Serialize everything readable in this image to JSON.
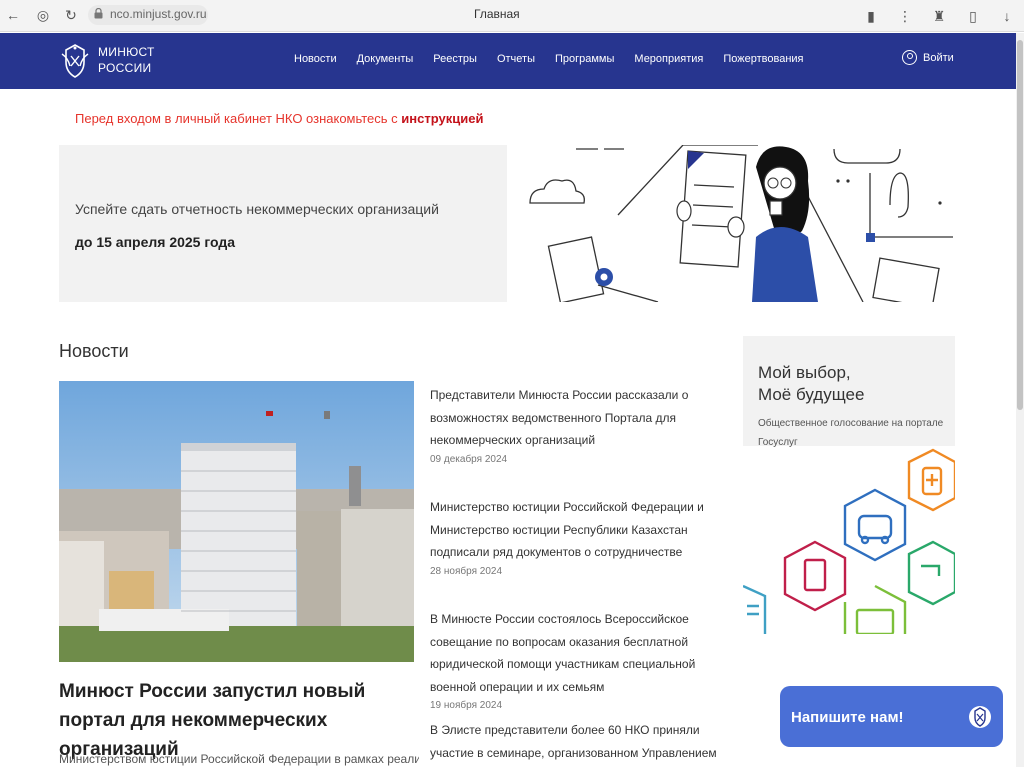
{
  "browser": {
    "url": "nco.minjust.gov.ru",
    "tab_title": "Главная"
  },
  "header": {
    "brand_line1": "МИНЮСТ",
    "brand_line2": "РОССИИ",
    "menu": [
      "Новости",
      "Документы",
      "Реестры",
      "Отчеты",
      "Программы",
      "Мероприятия",
      "Пожертвования"
    ],
    "login_label": "Войти"
  },
  "notice": {
    "text": "Перед входом в личный кабинет НКО ознакомьтесь с ",
    "link_text": "инструкцией"
  },
  "banner": {
    "line1": "Успейте сдать отчетность некоммерческих организаций",
    "line2": "до 15 апреля 2025 года"
  },
  "news": {
    "heading": "Новости",
    "feature_title": "Минюст России запустил новый портал для некоммерческих организаций",
    "feature_lead": "Министерством юстиции Российской Федерации в рамках реализации",
    "items": [
      {
        "title": "Представители Минюста России рассказали о возможностях ведомственного Портала для некоммерческих организаций",
        "date": "09 декабря 2024"
      },
      {
        "title": "Министерство юстиции Российской Федерации и Министерство юстиции Республики Казахстан подписали ряд документов о сотрудничестве",
        "date": "28 ноября 2024"
      },
      {
        "title": "В Минюсте России состоялось Всероссийское совещание по вопросам оказания бесплатной юридической помощи участникам специальной военной операции и их семьям",
        "date": "19 ноября 2024"
      },
      {
        "title": "В Элисте представители более 60 НКО приняли участие в семинаре, организованном Управлением Минюста России",
        "date": ""
      }
    ]
  },
  "promo": {
    "title_line1": "Мой выбор,",
    "title_line2": "Моё будущее",
    "subtitle": "Общественное голосование на портале Госуслуг"
  },
  "chat": {
    "label": "Напишите нам!"
  },
  "colors": {
    "header_bg": "#27358f",
    "notice_red": "#e6342c",
    "chat_bg": "#4a6fd6"
  }
}
